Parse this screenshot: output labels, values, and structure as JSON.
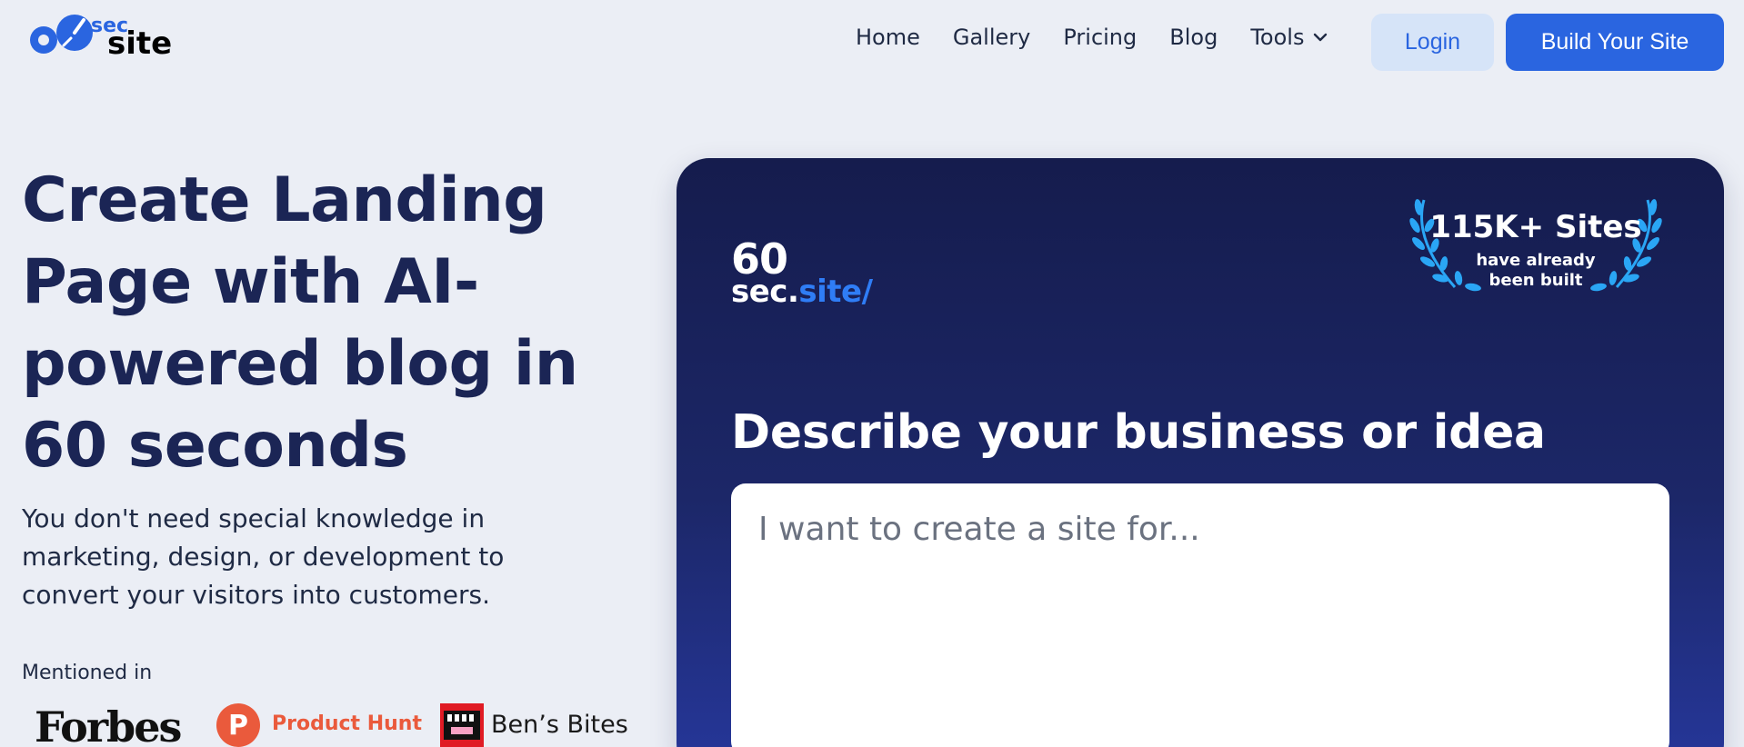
{
  "header": {
    "logo": {
      "number": "60",
      "small": "sec",
      "word": "site"
    },
    "nav": [
      {
        "label": "Home"
      },
      {
        "label": "Gallery"
      },
      {
        "label": "Pricing"
      },
      {
        "label": "Blog"
      },
      {
        "label": "Tools",
        "icon": "chevron-down-icon"
      }
    ],
    "login_label": "Login",
    "build_label": "Build Your Site"
  },
  "hero": {
    "title": "Create Landing Page with AI-powered blog in 60 seconds",
    "subtitle": "You don't need special knowledge in marketing, design, or development to convert your visitors into customers.",
    "mentioned_label": "Mentioned in",
    "press": [
      {
        "name": "Forbes"
      },
      {
        "name": "Product Hunt",
        "icon_letter": "P"
      },
      {
        "name": "Ben’s Bites"
      }
    ]
  },
  "card": {
    "logo_line1": "60",
    "logo_line2_a": "sec.",
    "logo_line2_b": "site/",
    "badge_title": "115K+ Sites",
    "badge_sub_line1": "have already",
    "badge_sub_line2": "been built",
    "heading": "Describe your business or idea",
    "input_placeholder": "I want to create a site for...",
    "input_value": ""
  },
  "colors": {
    "page_bg": "#ebeef5",
    "brand_blue": "#2a65e0",
    "login_bg": "#d6e4f8",
    "heading_navy": "#1b2555",
    "card_top": "#151c4d",
    "card_bottom": "#26379b",
    "laurel": "#2aa6f5",
    "product_hunt": "#ea5a3c"
  }
}
